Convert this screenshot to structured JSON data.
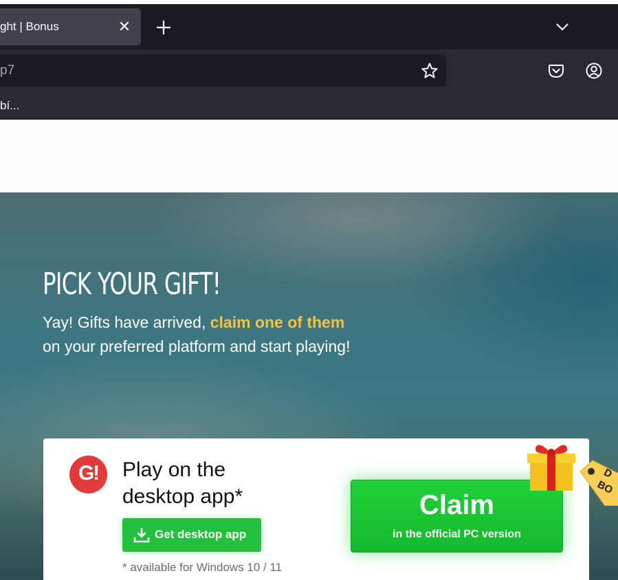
{
  "browser": {
    "tab": {
      "title": "ght | Bonus",
      "close": "✕"
    },
    "url": "p7",
    "bookmark": "bí..."
  },
  "hero": {
    "title": "PICK YOUR GIFT!",
    "subtitle_before": "Yay! Gifts have arrived, ",
    "subtitle_highlight": "claim one of them",
    "subtitle_after": "on your preferred platform and start playing!",
    "highlight_color": "#f5c244"
  },
  "card": {
    "logo_text": "G!",
    "heading_line1": "Play on the",
    "heading_line2": "desktop app*",
    "get_app_label": "Get desktop app",
    "note": "* available for Windows 10 / 11",
    "claim_label": "Claim",
    "claim_sub": "in the official PC version",
    "tag_text_1": "D",
    "tag_text_2": "BO",
    "accent": "#22c03c",
    "logo_color": "#e23a3a"
  }
}
